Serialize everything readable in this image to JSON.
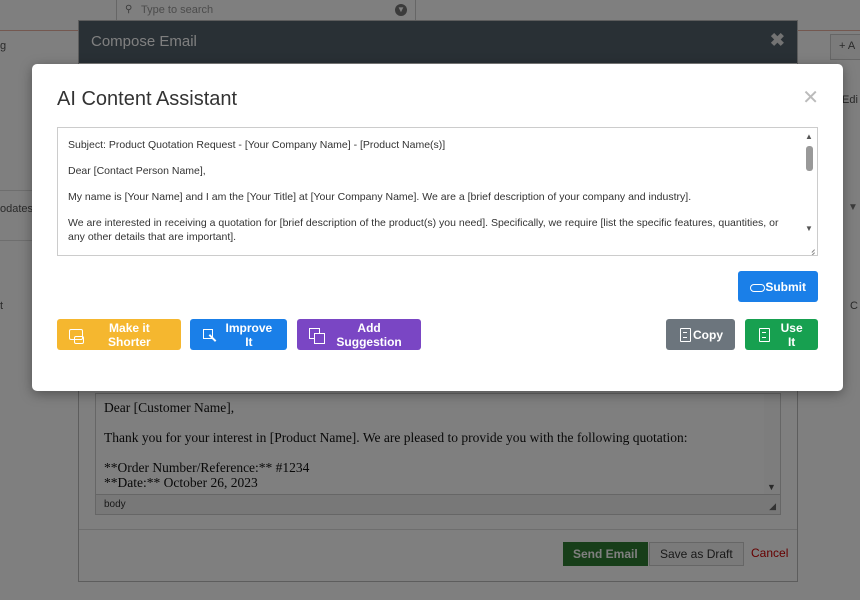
{
  "background": {
    "search_placeholder": "Type to search",
    "left_g": "g",
    "left_updates": "odates",
    "left_t": "t",
    "right_add": "+ A",
    "right_edit": "Edi",
    "right_c": "C"
  },
  "compose": {
    "title": "Compose Email",
    "editor_text": "Dear [Customer Name],\n\nThank you for your interest in [Product Name]. We are pleased to provide you with the following quotation:\n\n**Order Number/Reference:** #1234\n**Date:** October 26, 2023",
    "status_path": "body",
    "send_label": "Send Email",
    "draft_label": "Save as Draft",
    "cancel_label": "Cancel"
  },
  "assistant": {
    "title": "AI Content Assistant",
    "content": {
      "line1": "Subject: Product Quotation Request - [Your Company Name] - [Product Name(s)]",
      "line2": "Dear [Contact Person Name],",
      "line3": "My name is [Your Name] and I am the [Your Title] at [Your Company Name]. We are a [brief description of your company and industry].",
      "line4": "We are interested in receiving a quotation for [brief description of the product(s) you need].  Specifically, we require [list the specific features, quantities, or any other details that are important]."
    },
    "submit_label": "Submit",
    "shorter_label": "Make it Shorter",
    "improve_label": "Improve It",
    "suggest_label": "Add Suggestion",
    "copy_label": "Copy",
    "use_label": "Use It"
  },
  "colors": {
    "primary": "#1a7fe8",
    "warning": "#f5b72f",
    "purple": "#7a46c4",
    "secondary": "#6c757d",
    "success": "#17a050",
    "send": "#2e7d32",
    "cancel": "#cc0000"
  }
}
